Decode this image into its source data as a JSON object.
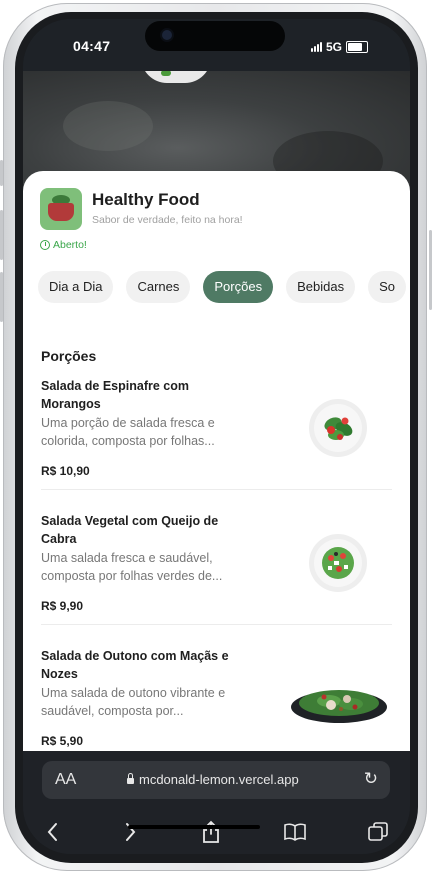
{
  "status_bar": {
    "time": "04:47",
    "network": "5G"
  },
  "restaurant": {
    "name": "Healthy Food",
    "tagline": "Sabor de verdade, feito na hora!",
    "status": "Aberto!"
  },
  "categories": [
    "Dia a Dia",
    "Carnes",
    "Porções",
    "Bebidas",
    "So"
  ],
  "active_category": "Porções",
  "section_title": "Porções",
  "products": [
    {
      "name": "Salada de Espinafre com Morangos",
      "description": "Uma porção de salada fresca e colorida, composta por folhas...",
      "price": "R$ 10,90"
    },
    {
      "name": "Salada Vegetal com Queijo de Cabra",
      "description": "Uma salada fresca e saudável, composta por folhas verdes de...",
      "price": "R$ 9,90"
    },
    {
      "name": "Salada de Outono com Maçãs e Nozes",
      "description": "Uma salada de outono vibrante e saudável, composta por...",
      "price": "R$ 5,90"
    }
  ],
  "browser": {
    "aa_label": "AA",
    "url": "mcdonald-lemon.vercel.app"
  },
  "colors": {
    "accent": "#4f7a64",
    "open_status": "#3aa64a",
    "browser_bg": "#1f2227"
  }
}
